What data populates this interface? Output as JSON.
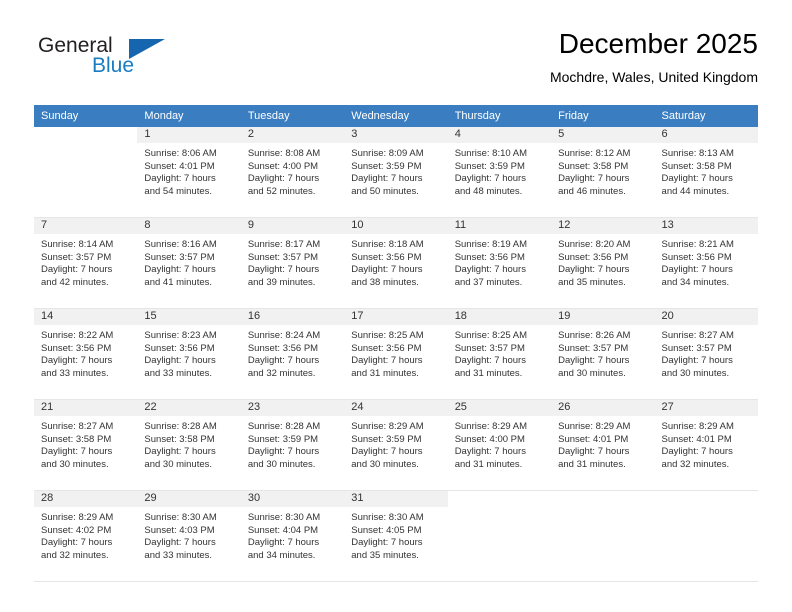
{
  "brand": {
    "word1": "General",
    "word2": "Blue",
    "triangle_icon": "triangle-icon",
    "accent_color": "#1566ae",
    "text_color": "#231f20"
  },
  "header": {
    "title": "December 2025",
    "subtitle": "Mochdre, Wales, United Kingdom"
  },
  "calendar": {
    "header_bg": "#3a7dc0",
    "header_text_color": "#ffffff",
    "daynum_bg": "#f1f1f1",
    "weekdays": [
      "Sunday",
      "Monday",
      "Tuesday",
      "Wednesday",
      "Thursday",
      "Friday",
      "Saturday"
    ],
    "weeks": [
      [
        {
          "day": "",
          "lines": []
        },
        {
          "day": "1",
          "lines": [
            "Sunrise: 8:06 AM",
            "Sunset: 4:01 PM",
            "Daylight: 7 hours",
            "and 54 minutes."
          ]
        },
        {
          "day": "2",
          "lines": [
            "Sunrise: 8:08 AM",
            "Sunset: 4:00 PM",
            "Daylight: 7 hours",
            "and 52 minutes."
          ]
        },
        {
          "day": "3",
          "lines": [
            "Sunrise: 8:09 AM",
            "Sunset: 3:59 PM",
            "Daylight: 7 hours",
            "and 50 minutes."
          ]
        },
        {
          "day": "4",
          "lines": [
            "Sunrise: 8:10 AM",
            "Sunset: 3:59 PM",
            "Daylight: 7 hours",
            "and 48 minutes."
          ]
        },
        {
          "day": "5",
          "lines": [
            "Sunrise: 8:12 AM",
            "Sunset: 3:58 PM",
            "Daylight: 7 hours",
            "and 46 minutes."
          ]
        },
        {
          "day": "6",
          "lines": [
            "Sunrise: 8:13 AM",
            "Sunset: 3:58 PM",
            "Daylight: 7 hours",
            "and 44 minutes."
          ]
        }
      ],
      [
        {
          "day": "7",
          "lines": [
            "Sunrise: 8:14 AM",
            "Sunset: 3:57 PM",
            "Daylight: 7 hours",
            "and 42 minutes."
          ]
        },
        {
          "day": "8",
          "lines": [
            "Sunrise: 8:16 AM",
            "Sunset: 3:57 PM",
            "Daylight: 7 hours",
            "and 41 minutes."
          ]
        },
        {
          "day": "9",
          "lines": [
            "Sunrise: 8:17 AM",
            "Sunset: 3:57 PM",
            "Daylight: 7 hours",
            "and 39 minutes."
          ]
        },
        {
          "day": "10",
          "lines": [
            "Sunrise: 8:18 AM",
            "Sunset: 3:56 PM",
            "Daylight: 7 hours",
            "and 38 minutes."
          ]
        },
        {
          "day": "11",
          "lines": [
            "Sunrise: 8:19 AM",
            "Sunset: 3:56 PM",
            "Daylight: 7 hours",
            "and 37 minutes."
          ]
        },
        {
          "day": "12",
          "lines": [
            "Sunrise: 8:20 AM",
            "Sunset: 3:56 PM",
            "Daylight: 7 hours",
            "and 35 minutes."
          ]
        },
        {
          "day": "13",
          "lines": [
            "Sunrise: 8:21 AM",
            "Sunset: 3:56 PM",
            "Daylight: 7 hours",
            "and 34 minutes."
          ]
        }
      ],
      [
        {
          "day": "14",
          "lines": [
            "Sunrise: 8:22 AM",
            "Sunset: 3:56 PM",
            "Daylight: 7 hours",
            "and 33 minutes."
          ]
        },
        {
          "day": "15",
          "lines": [
            "Sunrise: 8:23 AM",
            "Sunset: 3:56 PM",
            "Daylight: 7 hours",
            "and 33 minutes."
          ]
        },
        {
          "day": "16",
          "lines": [
            "Sunrise: 8:24 AM",
            "Sunset: 3:56 PM",
            "Daylight: 7 hours",
            "and 32 minutes."
          ]
        },
        {
          "day": "17",
          "lines": [
            "Sunrise: 8:25 AM",
            "Sunset: 3:56 PM",
            "Daylight: 7 hours",
            "and 31 minutes."
          ]
        },
        {
          "day": "18",
          "lines": [
            "Sunrise: 8:25 AM",
            "Sunset: 3:57 PM",
            "Daylight: 7 hours",
            "and 31 minutes."
          ]
        },
        {
          "day": "19",
          "lines": [
            "Sunrise: 8:26 AM",
            "Sunset: 3:57 PM",
            "Daylight: 7 hours",
            "and 30 minutes."
          ]
        },
        {
          "day": "20",
          "lines": [
            "Sunrise: 8:27 AM",
            "Sunset: 3:57 PM",
            "Daylight: 7 hours",
            "and 30 minutes."
          ]
        }
      ],
      [
        {
          "day": "21",
          "lines": [
            "Sunrise: 8:27 AM",
            "Sunset: 3:58 PM",
            "Daylight: 7 hours",
            "and 30 minutes."
          ]
        },
        {
          "day": "22",
          "lines": [
            "Sunrise: 8:28 AM",
            "Sunset: 3:58 PM",
            "Daylight: 7 hours",
            "and 30 minutes."
          ]
        },
        {
          "day": "23",
          "lines": [
            "Sunrise: 8:28 AM",
            "Sunset: 3:59 PM",
            "Daylight: 7 hours",
            "and 30 minutes."
          ]
        },
        {
          "day": "24",
          "lines": [
            "Sunrise: 8:29 AM",
            "Sunset: 3:59 PM",
            "Daylight: 7 hours",
            "and 30 minutes."
          ]
        },
        {
          "day": "25",
          "lines": [
            "Sunrise: 8:29 AM",
            "Sunset: 4:00 PM",
            "Daylight: 7 hours",
            "and 31 minutes."
          ]
        },
        {
          "day": "26",
          "lines": [
            "Sunrise: 8:29 AM",
            "Sunset: 4:01 PM",
            "Daylight: 7 hours",
            "and 31 minutes."
          ]
        },
        {
          "day": "27",
          "lines": [
            "Sunrise: 8:29 AM",
            "Sunset: 4:01 PM",
            "Daylight: 7 hours",
            "and 32 minutes."
          ]
        }
      ],
      [
        {
          "day": "28",
          "lines": [
            "Sunrise: 8:29 AM",
            "Sunset: 4:02 PM",
            "Daylight: 7 hours",
            "and 32 minutes."
          ]
        },
        {
          "day": "29",
          "lines": [
            "Sunrise: 8:30 AM",
            "Sunset: 4:03 PM",
            "Daylight: 7 hours",
            "and 33 minutes."
          ]
        },
        {
          "day": "30",
          "lines": [
            "Sunrise: 8:30 AM",
            "Sunset: 4:04 PM",
            "Daylight: 7 hours",
            "and 34 minutes."
          ]
        },
        {
          "day": "31",
          "lines": [
            "Sunrise: 8:30 AM",
            "Sunset: 4:05 PM",
            "Daylight: 7 hours",
            "and 35 minutes."
          ]
        },
        {
          "day": "",
          "lines": []
        },
        {
          "day": "",
          "lines": []
        },
        {
          "day": "",
          "lines": []
        }
      ]
    ]
  }
}
